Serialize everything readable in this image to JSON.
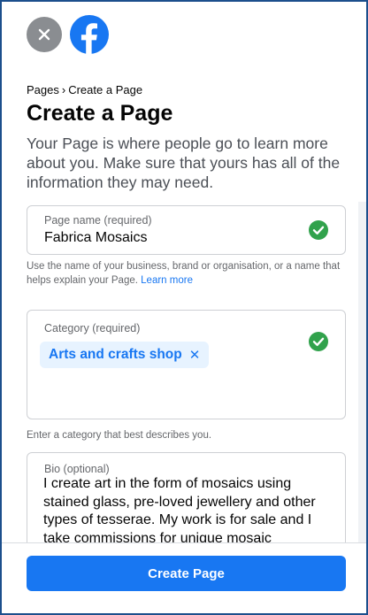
{
  "header": {
    "close_icon": "close-icon",
    "logo_icon": "facebook-logo-icon"
  },
  "breadcrumb": {
    "parent": "Pages",
    "separator": "›",
    "current": "Create a Page"
  },
  "page": {
    "title": "Create a Page",
    "description": "Your Page is where people go to learn more about you. Make sure that yours has all of the information they may need."
  },
  "form": {
    "page_name": {
      "label": "Page name (required)",
      "value": "Fabrica Mosaics",
      "valid_icon": "check-circle-icon",
      "helper": "Use the name of your business, brand or organisation, or a name that helps explain your Page.",
      "helper_link": "Learn more"
    },
    "category": {
      "label": "Category (required)",
      "selected": "Arts and crafts shop",
      "remove_glyph": "✕",
      "valid_icon": "check-circle-icon",
      "helper": "Enter a category that best describes you."
    },
    "bio": {
      "label": "Bio (optional)",
      "value": "I create art in the form of mosaics using stained glass, pre-loved jewellery and other types of tesserae. My work is for sale and I take commissions for unique mosaic creations."
    }
  },
  "footer": {
    "create_button": "Create Page"
  },
  "colors": {
    "accent": "#1877f2",
    "success": "#31a24c",
    "chip_bg": "#e7f3ff",
    "frame_border": "#1c4f8c"
  }
}
